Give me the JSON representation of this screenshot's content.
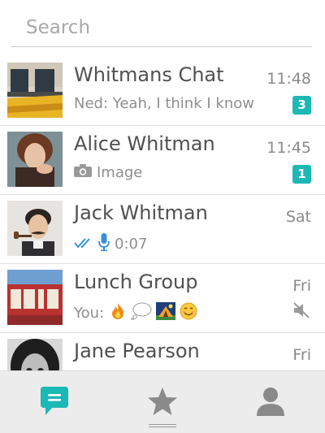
{
  "search": {
    "placeholder": "Search",
    "value": ""
  },
  "chats": [
    {
      "name": "Whitmans Chat",
      "time": "11:48",
      "preview": "Ned: Yeah, I think I know",
      "badge": "3"
    },
    {
      "name": "Alice Whitman",
      "time": "11:45",
      "preview": "Image",
      "badge": "1",
      "preview_icon": "camera-icon"
    },
    {
      "name": "Jack Whitman",
      "time": "Sat",
      "preview": "0:07",
      "preview_icons": [
        "double-check-icon",
        "microphone-icon"
      ]
    },
    {
      "name": "Lunch Group",
      "time": "Fri",
      "preview": "You:",
      "preview_icons": [
        "fire-emoji",
        "thought-bubble-emoji",
        "tent-emoji",
        "smiling-face-emoji"
      ],
      "status_icon": "muted-icon"
    },
    {
      "name": "Jane Pearson",
      "time": "Fri"
    }
  ],
  "tabs": [
    {
      "name": "chats",
      "icon": "chat-bubble-icon",
      "active": true
    },
    {
      "name": "favorites",
      "icon": "star-icon",
      "active": false
    },
    {
      "name": "contacts",
      "icon": "person-icon",
      "active": false
    }
  ],
  "colors": {
    "accent": "#1cb8b6",
    "tabbar": "#ececec",
    "icon_gray": "#8a8a8a",
    "check_blue": "#3a8fd8"
  }
}
